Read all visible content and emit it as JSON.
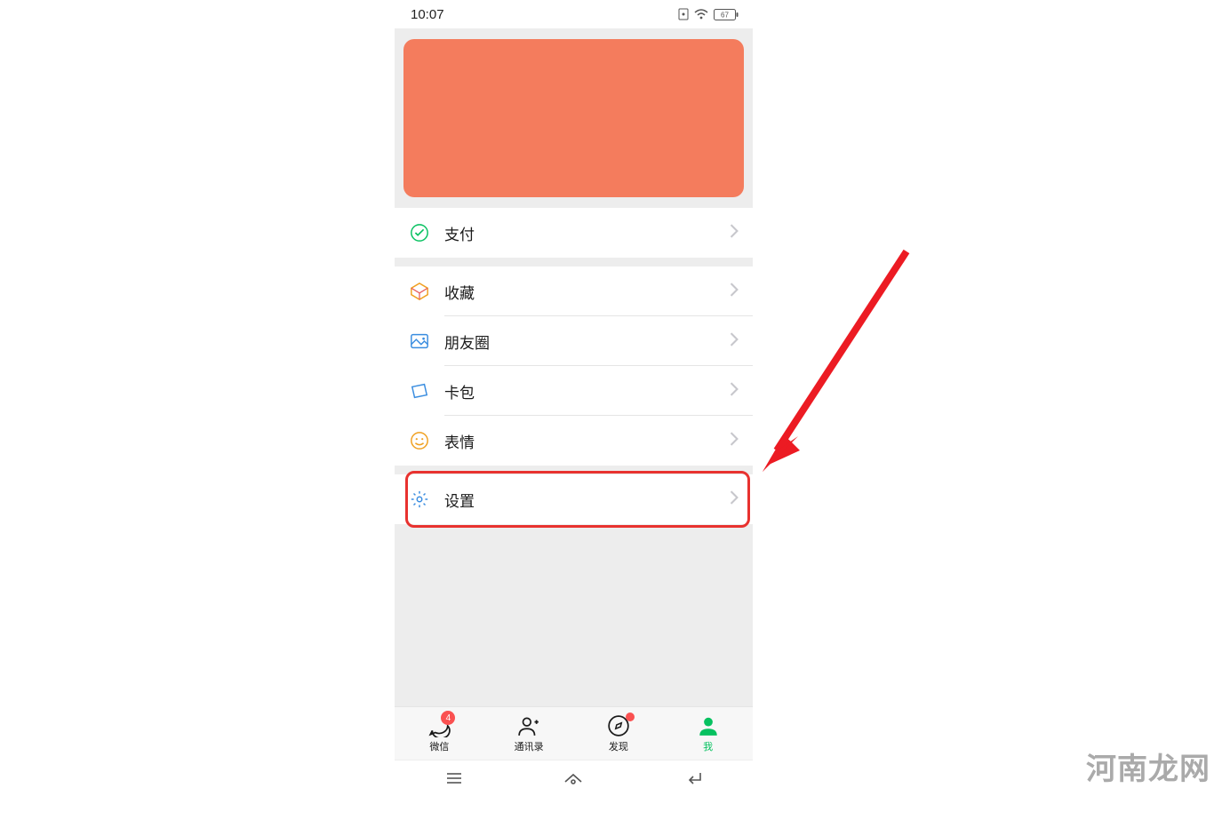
{
  "status_bar": {
    "time": "10:07",
    "battery_text": "67"
  },
  "menu": {
    "pay": {
      "label": "支付",
      "icon": "pay-icon"
    },
    "favorites": {
      "label": "收藏",
      "icon": "favorites-icon"
    },
    "moments": {
      "label": "朋友圈",
      "icon": "moments-icon"
    },
    "cards": {
      "label": "卡包",
      "icon": "cards-icon"
    },
    "sticker": {
      "label": "表情",
      "icon": "sticker-icon"
    },
    "settings": {
      "label": "设置",
      "icon": "settings-icon"
    }
  },
  "colors": {
    "profile_bg": "#f47c5d",
    "highlight": "#e8322f",
    "arrow": "#ec1b23",
    "active": "#07c160",
    "badge": "#fa5151"
  },
  "tabs": {
    "chats": {
      "label": "微信",
      "badge": "4"
    },
    "contacts": {
      "label": "通讯录"
    },
    "discover": {
      "label": "发现",
      "dot": true
    },
    "me": {
      "label": "我",
      "active": true
    }
  },
  "watermark": "河南龙网"
}
